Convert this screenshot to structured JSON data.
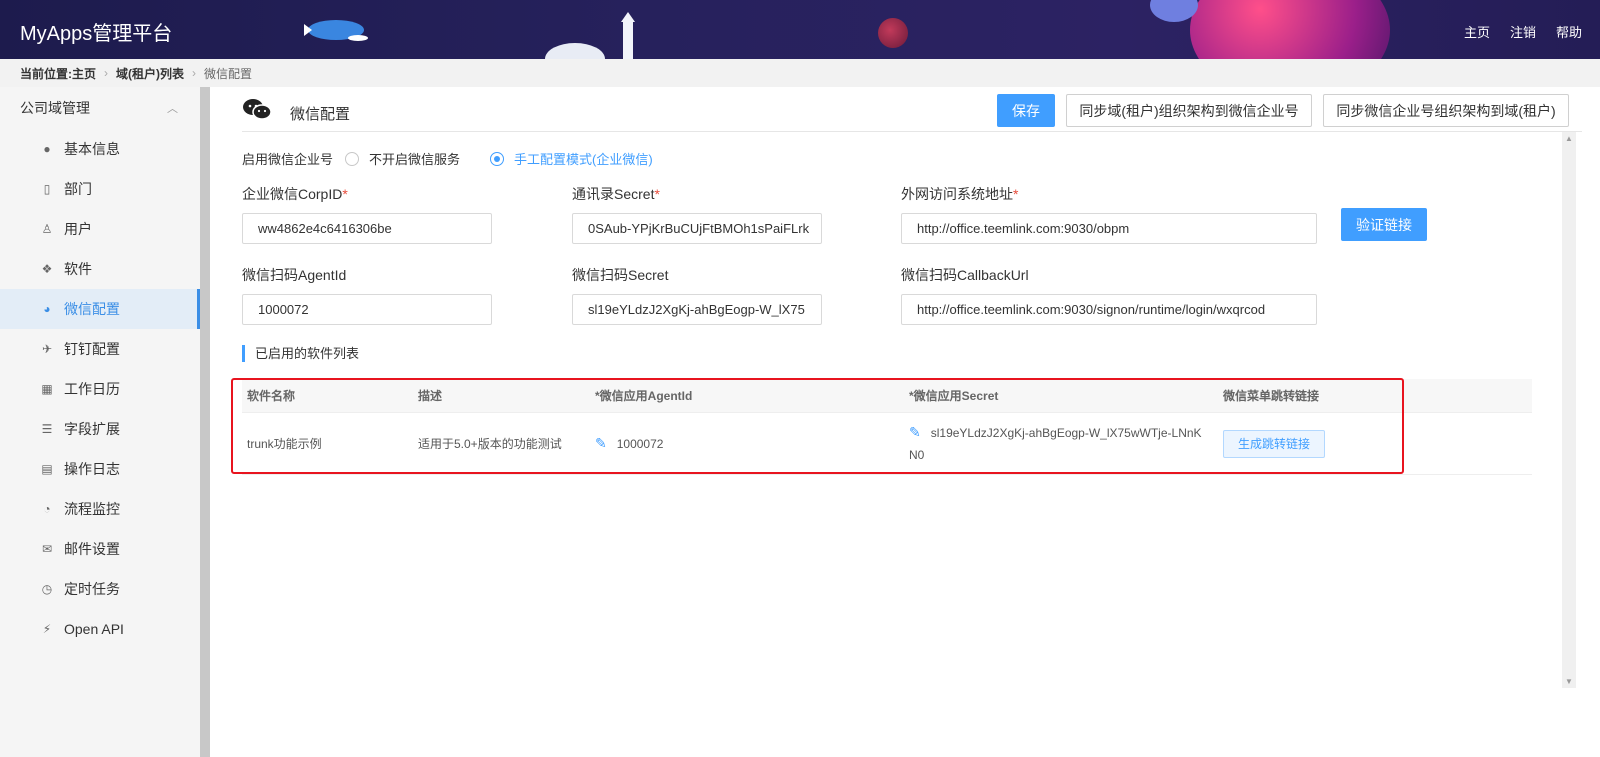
{
  "header": {
    "logo": "MyApps管理平台",
    "nav": [
      "主页",
      "注销",
      "帮助"
    ]
  },
  "breadcrumb": {
    "prefix": "当前位置:",
    "items": [
      "主页",
      "域(租户)列表",
      "微信配置"
    ]
  },
  "sidebar": {
    "group": "公司域管理",
    "items": [
      {
        "label": "基本信息",
        "icon": "info-icon"
      },
      {
        "label": "部门",
        "icon": "building-icon"
      },
      {
        "label": "用户",
        "icon": "user-icon"
      },
      {
        "label": "软件",
        "icon": "cubes-icon"
      },
      {
        "label": "微信配置",
        "icon": "wechat-icon"
      },
      {
        "label": "钉钉配置",
        "icon": "plane-icon"
      },
      {
        "label": "工作日历",
        "icon": "calendar-icon"
      },
      {
        "label": "字段扩展",
        "icon": "sliders-icon"
      },
      {
        "label": "操作日志",
        "icon": "log-icon"
      },
      {
        "label": "流程监控",
        "icon": "dashboard-icon"
      },
      {
        "label": "邮件设置",
        "icon": "mail-icon"
      },
      {
        "label": "定时任务",
        "icon": "clock-icon"
      },
      {
        "label": "Open API",
        "icon": "plug-icon"
      }
    ],
    "active": "微信配置"
  },
  "page": {
    "title": "微信配置",
    "save": "保存",
    "sync_to_wechat": "同步域(租户)组织架构到微信企业号",
    "sync_from_wechat": "同步微信企业号组织架构到域(租户)"
  },
  "enable": {
    "label": "启用微信企业号",
    "options": [
      "不开启微信服务",
      "手工配置模式(企业微信)"
    ],
    "selected": "手工配置模式(企业微信)"
  },
  "fields": {
    "corpid": {
      "label": "企业微信CorpID",
      "value": "ww4862e4c6416306be"
    },
    "contact_secret": {
      "label": "通讯录Secret",
      "value": "0SAub-YPjKrBuCUjFtBMOh1sPaiFLrk"
    },
    "external_url": {
      "label": "外网访问系统地址",
      "value": "http://office.teemlink.com:9030/obpm"
    },
    "verify": "验证链接",
    "agentid": {
      "label": "微信扫码AgentId",
      "value": "1000072"
    },
    "scan_secret": {
      "label": "微信扫码Secret",
      "value": "sl19eYLdzJ2XgKj-ahBgEogp-W_lX75"
    },
    "callback": {
      "label": "微信扫码CallbackUrl",
      "value": "http://office.teemlink.com:9030/signon/runtime/login/wxqrcod"
    }
  },
  "software": {
    "section_title": "已启用的软件列表",
    "columns": [
      "软件名称",
      "描述",
      "*微信应用AgentId",
      "*微信应用Secret",
      "微信菜单跳转链接"
    ],
    "rows": [
      {
        "name": "trunk功能示例",
        "desc": "适用于5.0+版本的功能测试",
        "agentid": "1000072",
        "secret": "sl19eYLdzJ2XgKj-ahBgEogp-W_lX75wWTje-LNnKN0",
        "action": "生成跳转链接"
      }
    ]
  },
  "colors": {
    "accent": "#409eff",
    "highlight": "#e8141f",
    "header": "#1d1b4d"
  }
}
